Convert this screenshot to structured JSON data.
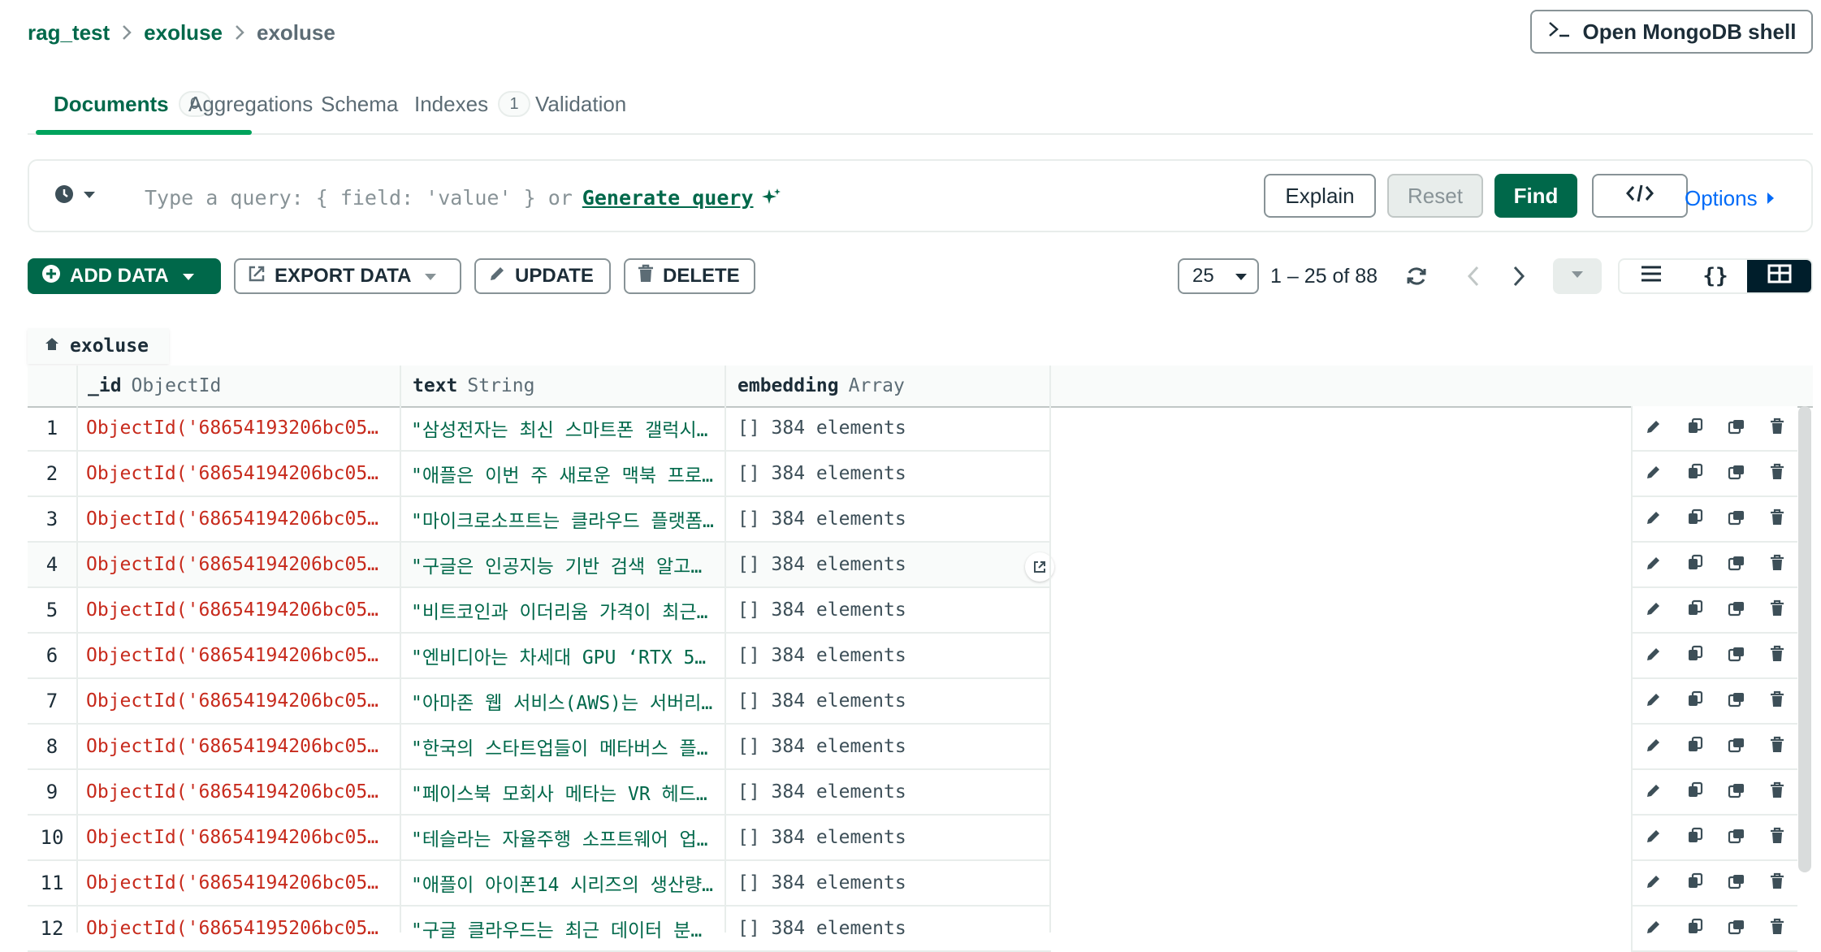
{
  "breadcrumb": {
    "db": "rag_test",
    "collection": "exoluse",
    "current": "exoluse"
  },
  "shell_button": {
    "label": "Open MongoDB shell"
  },
  "tabs": [
    {
      "label": "Documents",
      "badge": "0"
    },
    {
      "label": "Aggregations"
    },
    {
      "label": "Schema"
    },
    {
      "label": "Indexes",
      "badge": "1"
    },
    {
      "label": "Validation"
    }
  ],
  "query": {
    "placeholder": "Type a query: { field: 'value' } or",
    "generate_label": "Generate query",
    "explain_label": "Explain",
    "reset_label": "Reset",
    "find_label": "Find",
    "options_label": "Options"
  },
  "toolbar": {
    "add_data": "ADD DATA",
    "export_data": "EXPORT DATA",
    "update": "UPDATE",
    "delete": "DELETE",
    "page_size": "25",
    "range": "1 – 25 of 88"
  },
  "table": {
    "collection_tab": "exoluse",
    "columns": [
      {
        "name": "_id",
        "type": "ObjectId"
      },
      {
        "name": "text",
        "type": "String"
      },
      {
        "name": "embedding",
        "type": "Array"
      }
    ],
    "rows": [
      {
        "num": "1",
        "id": "ObjectId('68654193206bc05…",
        "text": "\"삼성전자는 최신 스마트폰 갤럭시…",
        "embedding": "[] 384 elements"
      },
      {
        "num": "2",
        "id": "ObjectId('68654194206bc05…",
        "text": "\"애플은 이번 주 새로운 맥북 프로…",
        "embedding": "[] 384 elements"
      },
      {
        "num": "3",
        "id": "ObjectId('68654194206bc05…",
        "text": "\"마이크로소프트는 클라우드 플랫폼…",
        "embedding": "[] 384 elements"
      },
      {
        "num": "4",
        "id": "ObjectId('68654194206bc05…",
        "text": "\"구글은 인공지능 기반 검색 알고…",
        "embedding": "[] 384 elements"
      },
      {
        "num": "5",
        "id": "ObjectId('68654194206bc05…",
        "text": "\"비트코인과 이더리움 가격이 최근…",
        "embedding": "[] 384 elements"
      },
      {
        "num": "6",
        "id": "ObjectId('68654194206bc05…",
        "text": "\"엔비디아는 차세대 GPU ‘RTX 5…",
        "embedding": "[] 384 elements"
      },
      {
        "num": "7",
        "id": "ObjectId('68654194206bc05…",
        "text": "\"아마존 웹 서비스(AWS)는 서버리…",
        "embedding": "[] 384 elements"
      },
      {
        "num": "8",
        "id": "ObjectId('68654194206bc05…",
        "text": "\"한국의 스타트업들이 메타버스 플…",
        "embedding": "[] 384 elements"
      },
      {
        "num": "9",
        "id": "ObjectId('68654194206bc05…",
        "text": "\"페이스북 모회사 메타는 VR 헤드…",
        "embedding": "[] 384 elements"
      },
      {
        "num": "10",
        "id": "ObjectId('68654194206bc05…",
        "text": "\"테슬라는 자율주행 소프트웨어 업…",
        "embedding": "[] 384 elements"
      },
      {
        "num": "11",
        "id": "ObjectId('68654194206bc05…",
        "text": "\"애플이 아이폰14 시리즈의 생산량…",
        "embedding": "[] 384 elements"
      },
      {
        "num": "12",
        "id": "ObjectId('68654195206bc05…",
        "text": "\"구글 클라우드는 최근 데이터 분…",
        "embedding": "[] 384 elements"
      }
    ]
  },
  "colors": {
    "accent": "#00684a",
    "id_text": "#c72a1c",
    "link_blue": "#016bf8"
  },
  "icons": [
    "chevron-right-icon",
    "terminal-icon",
    "clock-icon",
    "caret-down-icon",
    "sparkle-icon",
    "code-icon",
    "plus-circle-icon",
    "export-icon",
    "pencil-icon",
    "trash-icon",
    "refresh-icon",
    "chevron-left-icon",
    "list-view-icon",
    "json-view-icon",
    "table-view-icon",
    "home-icon",
    "open-external-icon",
    "copy-icon",
    "clone-icon"
  ]
}
